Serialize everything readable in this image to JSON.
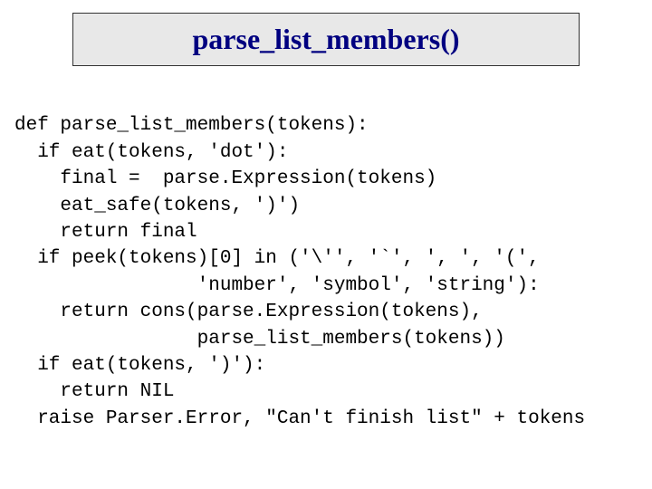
{
  "title": "parse_list_members()",
  "code": {
    "line01": "def parse_list_members(tokens):",
    "line02": "  if eat(tokens, 'dot'):",
    "line03": "    final =  parse.Expression(tokens)",
    "line04": "    eat_safe(tokens, ')')",
    "line05": "    return final",
    "line06": "  if peek(tokens)[0] in ('\\'', '`', ', ', '(',",
    "line07": "                'number', 'symbol', 'string'):",
    "line08": "    return cons(parse.Expression(tokens),",
    "line09": "                parse_list_members(tokens))",
    "line10": "  if eat(tokens, ')'):",
    "line11": "    return NIL",
    "line12": "  raise Parser.Error, \"Can't finish list\" + tokens"
  }
}
